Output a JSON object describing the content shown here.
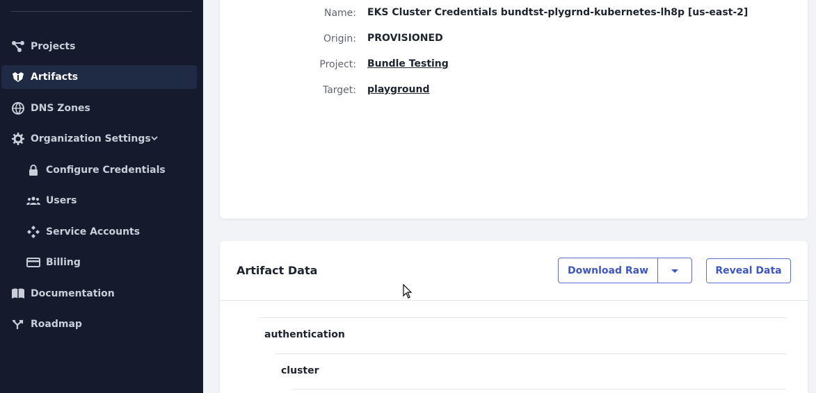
{
  "sidebar": {
    "items": [
      {
        "label": "Projects",
        "icon": "projects-icon"
      },
      {
        "label": "Artifacts",
        "icon": "artifacts-icon",
        "active": true
      },
      {
        "label": "DNS Zones",
        "icon": "globe-icon"
      },
      {
        "label": "Organization Settings",
        "icon": "gear-icon"
      },
      {
        "label": "Configure Credentials",
        "icon": "lock-icon"
      },
      {
        "label": "Users",
        "icon": "users-icon"
      },
      {
        "label": "Service Accounts",
        "icon": "service-accounts-icon"
      },
      {
        "label": "Billing",
        "icon": "credit-card-icon"
      },
      {
        "label": "Documentation",
        "icon": "book-icon"
      },
      {
        "label": "Roadmap",
        "icon": "roadmap-icon"
      }
    ]
  },
  "details": {
    "name_label": "Name:",
    "name_value": "EKS Cluster Credentials bundtst-plygrnd-kubernetes-lh8p [us-east-2]",
    "origin_label": "Origin:",
    "origin_value": "PROVISIONED",
    "project_label": "Project:",
    "project_value": "Bundle Testing",
    "target_label": "Target:",
    "target_value": "playground"
  },
  "artifact_data": {
    "title": "Artifact Data",
    "download_label": "Download Raw",
    "reveal_label": "Reveal Data",
    "tree": [
      "authentication",
      "cluster"
    ]
  },
  "colors": {
    "sidebar_bg": "#151b2c",
    "accent": "#3f56c2"
  }
}
